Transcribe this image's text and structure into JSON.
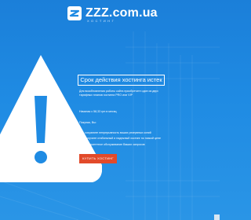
{
  "logo": {
    "text": "ZZZ.com.ua",
    "subtitle": "ХОСТИНГ"
  },
  "main": {
    "title": "Срок действия хостинга истек",
    "intro": "Для возобновления работы сайта приобретите один из двух тарифных планов хостинга PRO или VIP",
    "price": "Начиная с 58,33 грн в месяц",
    "buy_label": "Покупая, Вы:",
    "features": [
      "сохраните непрерывность ваших резервных копий",
      "получите стабильный и надежный хостинг по низкой цене",
      "приоритетное обслуживание Ваших запросов"
    ],
    "button_label": "КУПИТЬ ХОСТИНГ"
  },
  "colors": {
    "background": "#1f8be3",
    "button": "#e24a2a",
    "text": "#ffffff"
  },
  "icons": {
    "logo": "zzz-logo-icon",
    "warning": "warning-triangle-icon",
    "check": "check-icon"
  }
}
